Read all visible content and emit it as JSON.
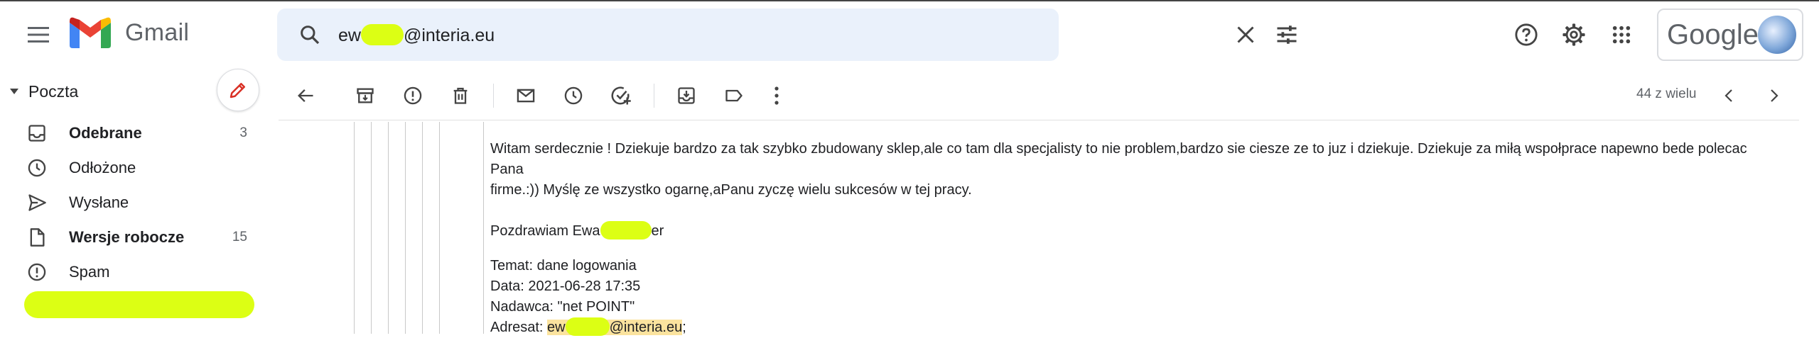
{
  "app": {
    "name": "Gmail",
    "brand_colors": {
      "red": "#ea4335",
      "blue": "#4285f4",
      "green": "#34a853",
      "yellow": "#fbbc04"
    }
  },
  "search": {
    "value_prefix": "ew",
    "value_suffix": "@interia.eu"
  },
  "account": {
    "label": "Google"
  },
  "sidebar": {
    "section": "Poczta",
    "items": [
      {
        "label": "Odebrane",
        "count": "3",
        "icon": "inbox-icon",
        "bold": true
      },
      {
        "label": "Odłożone",
        "count": "",
        "icon": "clock-icon",
        "bold": false
      },
      {
        "label": "Wysłane",
        "count": "",
        "icon": "send-icon",
        "bold": false
      },
      {
        "label": "Wersje robocze",
        "count": "15",
        "icon": "draft-icon",
        "bold": true
      },
      {
        "label": "Spam",
        "count": "",
        "icon": "spam-icon",
        "bold": false
      }
    ]
  },
  "toolbar": {
    "pager": "44 z wielu"
  },
  "message": {
    "line1": "Witam serdecznie ! Dziekuje bardzo za tak szybko zbudowany sklep,ale co tam dla specjalisty to nie problem,bardzo sie ciesze ze to juz i dziekuje. Dziekuje za miłą wspołprace  napewno bede polecac Pana",
    "line2": "firme.:)) Myślę ze wszystko ogarnę,aPanu zyczę wielu sukcesów w tej pracy.",
    "greeting_prefix": "Pozdrawiam Ewa",
    "greeting_suffix": "er",
    "subject": "Temat: dane logowania",
    "date": "Data: 2021-06-28 17:35",
    "sender": "Nadawca: \"net POINT\"",
    "recipient_label": "Adresat: ",
    "recipient_prefix": "ew",
    "recipient_suffix": "@interia.eu",
    "recipient_end": ";"
  },
  "highlight_color": "#dcff14"
}
